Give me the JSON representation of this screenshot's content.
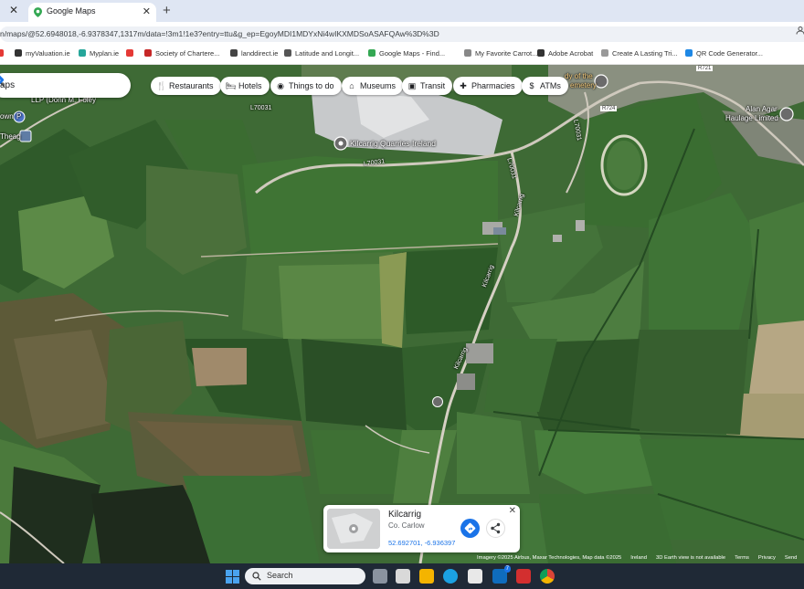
{
  "browser": {
    "tab_title": "Google Maps",
    "tab_close": "✕",
    "other_tab_close": "✕",
    "new_tab": "+",
    "url": "n/maps/@52.6948018,-6.9378347,1317m/data=!3m1!1e3?entry=ttu&g_ep=EgoyMDI1MDYxNi4wIKXMDSoASAFQAw%3D%3D",
    "bookmarks": [
      {
        "label": "myValuation.ie",
        "icon": "valuation-icon",
        "color": "#333333"
      },
      {
        "label": "Myplan.ie",
        "icon": "myplan-icon",
        "color": "#26a69a"
      },
      {
        "label": "",
        "icon": "youtube-icon",
        "color": "#e53935"
      },
      {
        "label": "Society of Chartere...",
        "icon": "scsi-icon",
        "color": "#c62828"
      },
      {
        "label": "landdirect.ie",
        "icon": "landdirect-icon",
        "color": "#444444"
      },
      {
        "label": "Latitude and Longit...",
        "icon": "latlong-icon",
        "color": "#555555"
      },
      {
        "label": "Google Maps - Find...",
        "icon": "maps-icon",
        "color": "#34a853"
      },
      {
        "label": "My Favorite Carrot...",
        "icon": "carrot-icon",
        "color": "#888888"
      },
      {
        "label": "Adobe Acrobat",
        "icon": "acrobat-icon",
        "color": "#333333"
      },
      {
        "label": "Create A Lasting Tri...",
        "icon": "tribute-icon",
        "color": "#999999"
      },
      {
        "label": "QR Code Generator...",
        "icon": "qr-icon",
        "color": "#1e88e5"
      }
    ]
  },
  "maps": {
    "search_text": "aps",
    "chips": [
      {
        "label": "Restaurants",
        "icon": "restaurant-icon"
      },
      {
        "label": "Hotels",
        "icon": "hotel-icon"
      },
      {
        "label": "Things to do",
        "icon": "camera-icon"
      },
      {
        "label": "Museums",
        "icon": "museum-icon"
      },
      {
        "label": "Transit",
        "icon": "transit-icon"
      },
      {
        "label": "Pharmacies",
        "icon": "pharmacy-icon"
      },
      {
        "label": "ATMs",
        "icon": "atm-icon"
      }
    ],
    "labels": {
      "quarries": "Kilcarrig Quarries Ireland",
      "haulage_1": "Alan Agar",
      "haulage_2": "Haulage Limited",
      "cemetery_1": "dy of the",
      "cemetery_2": "emetery",
      "lucey_1": "LLP (Donn M. Foley",
      "lucey_2": "own",
      "road_l7003_top": "L70031",
      "road_l7003_bottom": "L70031",
      "road_l70031_v": "L70031",
      "road_l7003_v2": "L70031",
      "road_r724": "R724",
      "road_r721": "R721",
      "road_kilcarrig_1": "Kilcarrig",
      "road_kilcarrig_2": "Kilcarrig",
      "road_kilcarrig_3": "Kilcarrig",
      "theag": "Theag",
      "parking": "P"
    },
    "card": {
      "title": "Kilcarrig",
      "subtitle": "Co. Carlow",
      "coords": "52.692701, -6.936397",
      "close": "✕"
    },
    "attribution": [
      "Imagery ©2025 Airbus, Maxar Technologies, Map data ©2025",
      "Ireland",
      "3D Earth view is not available",
      "Terms",
      "Privacy",
      "Send"
    ]
  },
  "taskbar": {
    "search_placeholder": "Search",
    "apps": [
      {
        "icon": "task-view-icon",
        "color": "#8a93a0"
      },
      {
        "icon": "widgets-icon",
        "color": "#d9d9d9"
      },
      {
        "icon": "file-explorer-icon",
        "color": "#f4b400"
      },
      {
        "icon": "edge-icon",
        "color": "#1ba1e2"
      },
      {
        "icon": "store-icon",
        "color": "#e8e8e8"
      },
      {
        "icon": "outlook-icon",
        "color": "#0f6cbd"
      },
      {
        "icon": "acrobat-icon",
        "color": "#d32f2f"
      },
      {
        "icon": "chrome-icon",
        "color": "#f1c40f"
      }
    ],
    "outlook_badge": "7"
  }
}
